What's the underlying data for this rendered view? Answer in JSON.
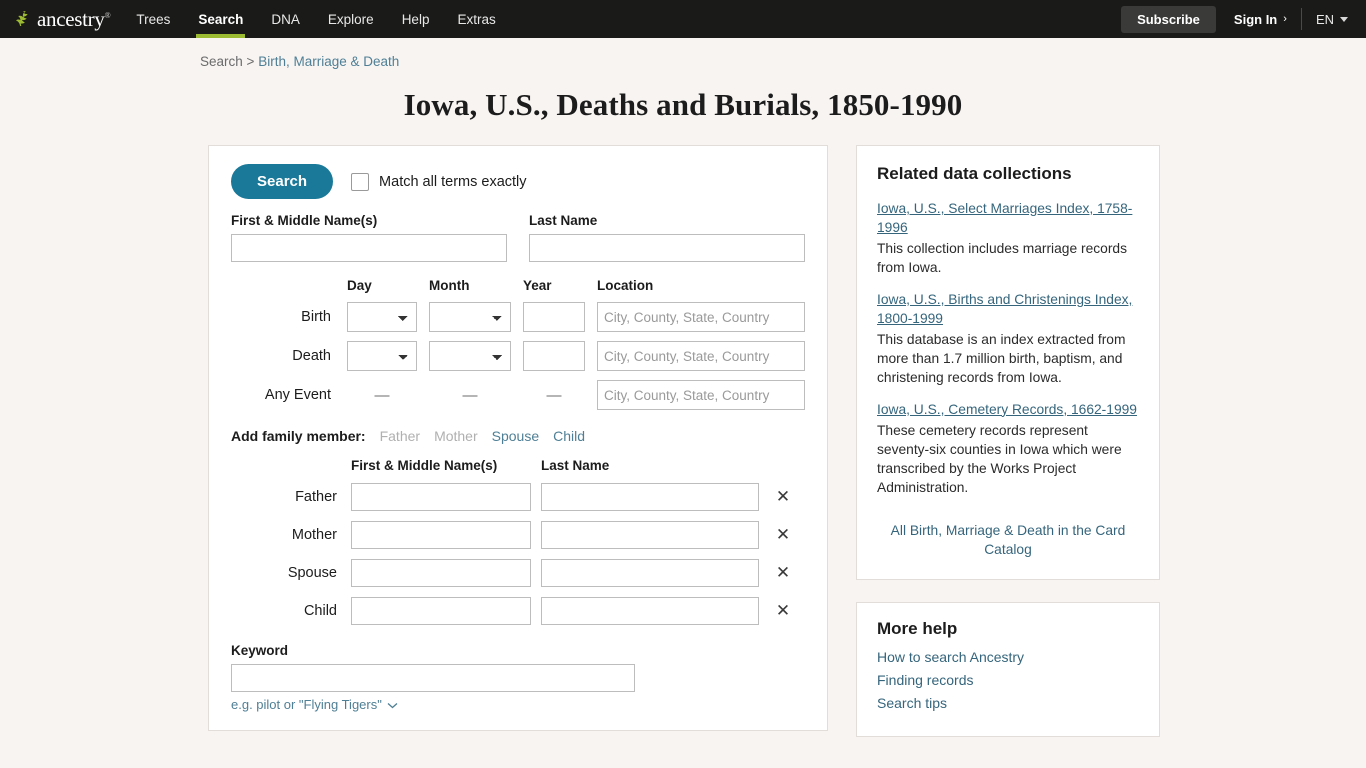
{
  "header": {
    "logo_text": "ancestry",
    "logo_tm": "®",
    "nav": [
      {
        "label": "Trees",
        "active": false
      },
      {
        "label": "Search",
        "active": true
      },
      {
        "label": "DNA",
        "active": false
      },
      {
        "label": "Explore",
        "active": false
      },
      {
        "label": "Help",
        "active": false
      },
      {
        "label": "Extras",
        "active": false
      }
    ],
    "subscribe_label": "Subscribe",
    "signin_label": "Sign In",
    "signin_chevron": "›",
    "language": "EN",
    "accent_green": "#9cbb32",
    "bar_color": "#1a1a18"
  },
  "breadcrumb": {
    "root": "Search",
    "separator": ">",
    "current": "Birth, Marriage & Death"
  },
  "page_title": "Iowa, U.S., Deaths and Burials, 1850-1990",
  "form": {
    "search_button": "Search",
    "match_exactly_label": "Match all terms exactly",
    "match_exactly_checked": false,
    "first_name_label": "First & Middle Name(s)",
    "first_name_value": "",
    "last_name_label": "Last Name",
    "last_name_value": "",
    "date_headers": {
      "day": "Day",
      "month": "Month",
      "year": "Year",
      "location": "Location"
    },
    "location_placeholder": "City, County, State, Country",
    "rows": [
      {
        "label": "Birth",
        "day": "",
        "month": "",
        "year": "",
        "location": ""
      },
      {
        "label": "Death",
        "day": "",
        "month": "",
        "year": "",
        "location": ""
      },
      {
        "label": "Any Event",
        "dash": "—",
        "location": ""
      }
    ],
    "family": {
      "heading": "Add family member:",
      "links": [
        {
          "label": "Father",
          "enabled": false
        },
        {
          "label": "Mother",
          "enabled": false
        },
        {
          "label": "Spouse",
          "enabled": true
        },
        {
          "label": "Child",
          "enabled": true
        }
      ],
      "col_first": "First & Middle Name(s)",
      "col_last": "Last Name",
      "remove_icon": "✕",
      "rows": [
        {
          "label": "Father",
          "first": "",
          "last": ""
        },
        {
          "label": "Mother",
          "first": "",
          "last": ""
        },
        {
          "label": "Spouse",
          "first": "",
          "last": ""
        },
        {
          "label": "Child",
          "first": "",
          "last": ""
        }
      ]
    },
    "keyword_label": "Keyword",
    "keyword_value": "",
    "keyword_hint": "e.g. pilot or \"Flying Tigers\""
  },
  "sidebar": {
    "related_title": "Related data collections",
    "collections": [
      {
        "title": "Iowa, U.S., Select Marriages Index, 1758-1996",
        "desc": "This collection includes marriage records from Iowa."
      },
      {
        "title": "Iowa, U.S., Births and Christenings Index, 1800-1999",
        "desc": "This database is an index extracted from more than 1.7 million birth, baptism, and christening records from Iowa."
      },
      {
        "title": "Iowa, U.S., Cemetery Records, 1662-1999",
        "desc": "These cemetery records represent seventy-six counties in Iowa which were transcribed by the Works Project Administration."
      }
    ],
    "catalog_link": "All Birth, Marriage & Death in the Card Catalog",
    "help_title": "More help",
    "help_links": [
      "How to search Ancestry",
      "Finding records",
      "Search tips"
    ]
  }
}
